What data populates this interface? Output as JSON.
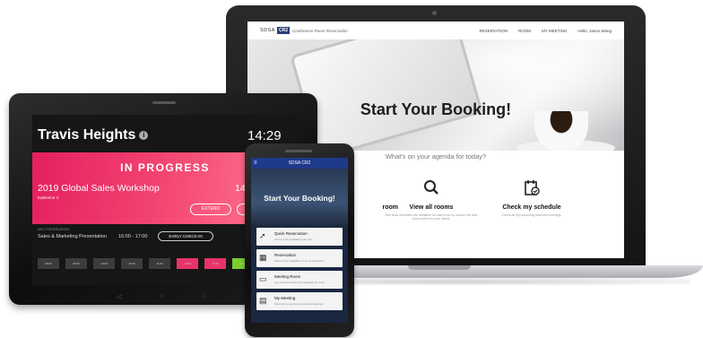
{
  "website": {
    "brand": "SDSA",
    "brand_badge": "CR2",
    "brand_subtitle": "Conference Room Reservation",
    "nav_links": [
      "RESERVATION",
      "ROOM",
      "MY MEETING"
    ],
    "user_greeting": "Hello, Jason Wang",
    "hero_title": "Start Your Booking!",
    "agenda_prompt": "What's on your agenda for today?",
    "features": [
      {
        "icon": "room-icon",
        "title": "room",
        "desc": ""
      },
      {
        "icon": "magnifier-icon",
        "title": "View all rooms",
        "desc": "See what amenities are available for each room to ensure the best room suited for your needs."
      },
      {
        "icon": "schedule-icon",
        "title": "Check my schedule",
        "desc": "Check all my upcoming reserved meetings."
      }
    ]
  },
  "tablet": {
    "room_name": "Travis Heights",
    "clock": "14:29",
    "status": "IN PROGRESS",
    "event_title": "2019 Global Sales Workshop",
    "event_time": "14",
    "event_host": "Katherine V.",
    "extend_label": "EXTEND",
    "next_label": "NEXT RESERVATION",
    "next_title": "Sales & Marketing Presentation",
    "next_time": "16:00 - 17:00",
    "early_checkin_label": "EARLY CHECK-IN",
    "slots": [
      {
        "label": "09:00",
        "state": "free"
      },
      {
        "label": "09:30",
        "state": "free"
      },
      {
        "label": "10:00",
        "state": "free"
      },
      {
        "label": "10:30",
        "state": "free"
      },
      {
        "label": "11:00",
        "state": "free"
      },
      {
        "label": "11:30",
        "state": "free"
      },
      {
        "label": "12:00",
        "state": "booked"
      },
      {
        "label": "12:30",
        "state": "booked"
      },
      {
        "label": "13:00",
        "state": "available"
      }
    ],
    "colors": {
      "banner": "#e51f60",
      "booked": "#e8336a",
      "available": "#7dcc2e"
    }
  },
  "phone": {
    "app_title": "SDSA CR2",
    "hero_title": "Start Your Booking!",
    "menu": [
      {
        "icon": "rocket-icon",
        "title": "Quick Reservation",
        "desc": "Find a room available right now."
      },
      {
        "icon": "calendar-icon",
        "title": "Reservation",
        "desc": "Find a room available on my desired time."
      },
      {
        "icon": "room-icon",
        "title": "Meeting Room",
        "desc": "See what amenities are available for room."
      },
      {
        "icon": "schedule-icon",
        "title": "My Meeting",
        "desc": "View all my upcoming reserved meetings."
      }
    ]
  }
}
